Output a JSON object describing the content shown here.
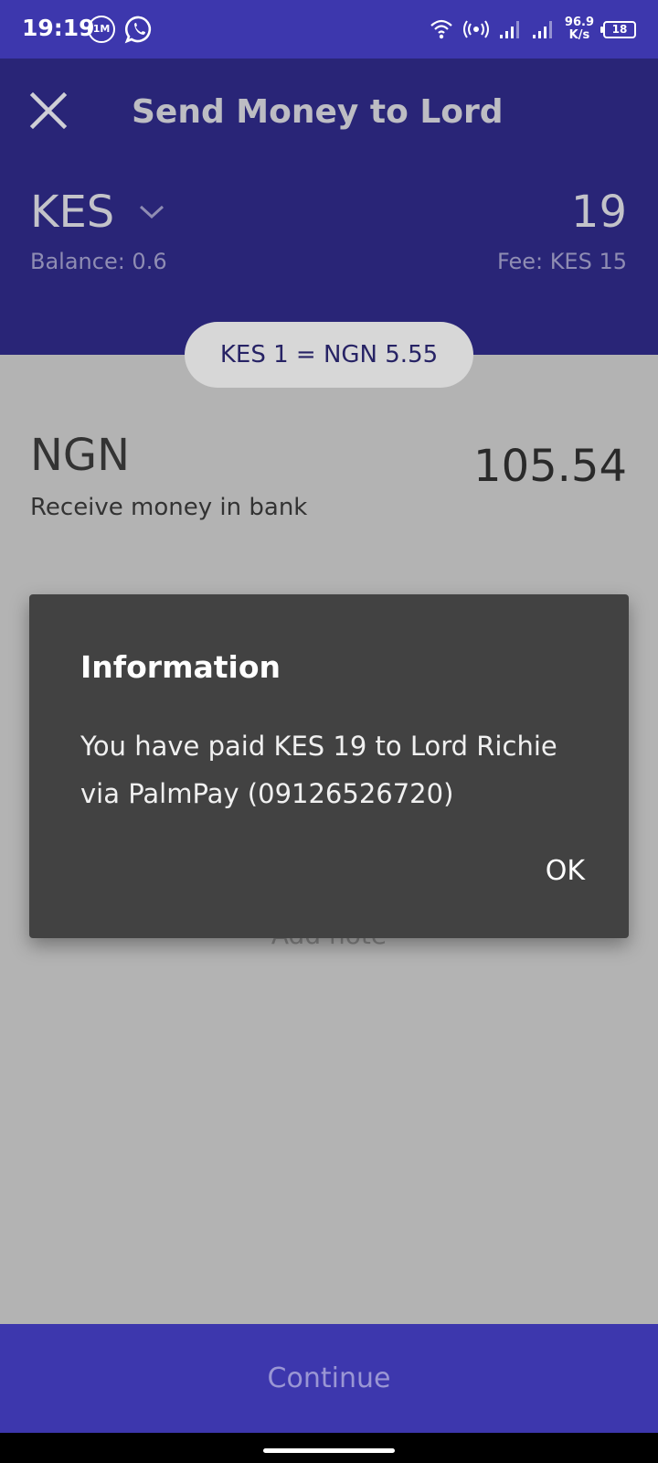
{
  "status_bar": {
    "time": "19:19",
    "icons": [
      "notification-1m-icon",
      "whatsapp-icon",
      "wifi-icon",
      "hotspot-icon",
      "signal-icon",
      "signal-icon"
    ],
    "net_speed_value": "96.9",
    "net_speed_unit": "K/s",
    "battery": "18"
  },
  "header": {
    "title": "Send Money to Lord",
    "from_currency": "KES",
    "balance": "Balance: 0.6",
    "amount": "19",
    "fee": "Fee: KES 15",
    "rate": "KES 1 = NGN 5.55"
  },
  "receive": {
    "currency": "NGN",
    "method": "Receive money in bank",
    "amount": "105.54"
  },
  "add_note": "Add note",
  "dialog": {
    "title": "Information",
    "message": "You have paid KES 19 to Lord Richie via PalmPay (09126526720)",
    "ok_label": "OK"
  },
  "continue_label": "Continue",
  "colors": {
    "status_bar": "#3d37ad",
    "header": "#292577",
    "body": "#b3b3b3",
    "dialog": "#424242",
    "continue_button": "#3d37ad"
  }
}
